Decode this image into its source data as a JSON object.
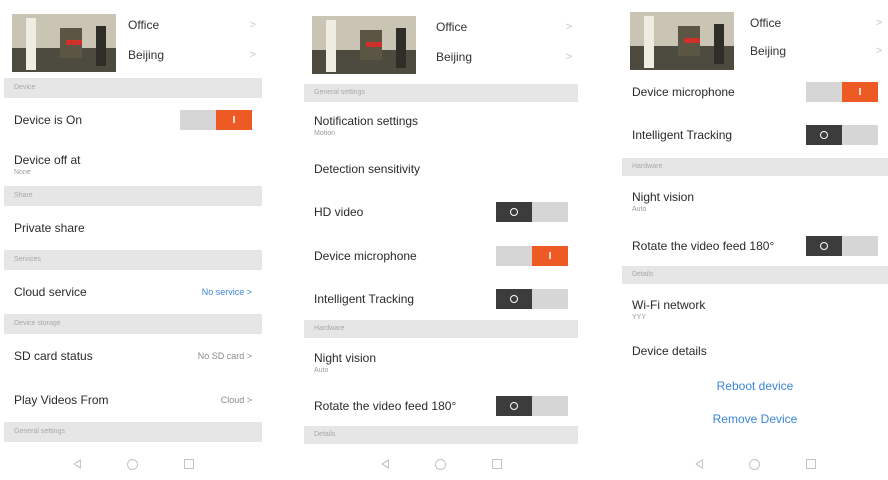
{
  "camera": {
    "location": "Office",
    "city": "Beijing"
  },
  "screen1": {
    "sections": {
      "device": "Device",
      "share": "Share",
      "services": "Services",
      "storage": "Device storage",
      "general": "General settings"
    },
    "device_on": {
      "label": "Device is On",
      "toggle_on_symbol": "I"
    },
    "device_off_at": {
      "label": "Device off at",
      "value": "None"
    },
    "private_share": {
      "label": "Private share"
    },
    "cloud_service": {
      "label": "Cloud service",
      "value": "No service >"
    },
    "sd_card": {
      "label": "SD card status",
      "value": "No SD card >"
    },
    "play_videos": {
      "label": "Play Videos From",
      "value": "Cloud >"
    }
  },
  "screen2": {
    "sections": {
      "general": "General settings",
      "hardware": "Hardware",
      "details": "Details"
    },
    "notification": {
      "label": "Notification settings",
      "value": "Motion"
    },
    "detection": {
      "label": "Detection sensitivity"
    },
    "hd_video": {
      "label": "HD video"
    },
    "microphone": {
      "label": "Device microphone",
      "toggle_on_symbol": "I"
    },
    "tracking": {
      "label": "Intelligent Tracking"
    },
    "night_vision": {
      "label": "Night vision",
      "value": "Auto"
    },
    "rotate": {
      "label": "Rotate the video feed 180°"
    }
  },
  "screen3": {
    "sections": {
      "hardware": "Hardware",
      "details": "Details"
    },
    "microphone": {
      "label": "Device microphone",
      "toggle_on_symbol": "I"
    },
    "tracking": {
      "label": "Intelligent Tracking"
    },
    "night_vision": {
      "label": "Night vision",
      "value": "Auto"
    },
    "rotate": {
      "label": "Rotate the video feed 180°"
    },
    "wifi": {
      "label": "Wi-Fi network",
      "value": "YYY"
    },
    "device_details": {
      "label": "Device details"
    },
    "reboot": "Reboot device",
    "remove": "Remove Device"
  },
  "chevron": ">",
  "colors": {
    "accent_orange": "#ee5a24",
    "link_blue": "#3a86d6",
    "section_bg": "#e6e6e6",
    "toggle_dark": "#3c3c3c"
  },
  "icons": [
    "back-icon",
    "home-icon",
    "recent-apps-icon",
    "chevron-right-icon",
    "toggle-ring-icon"
  ]
}
